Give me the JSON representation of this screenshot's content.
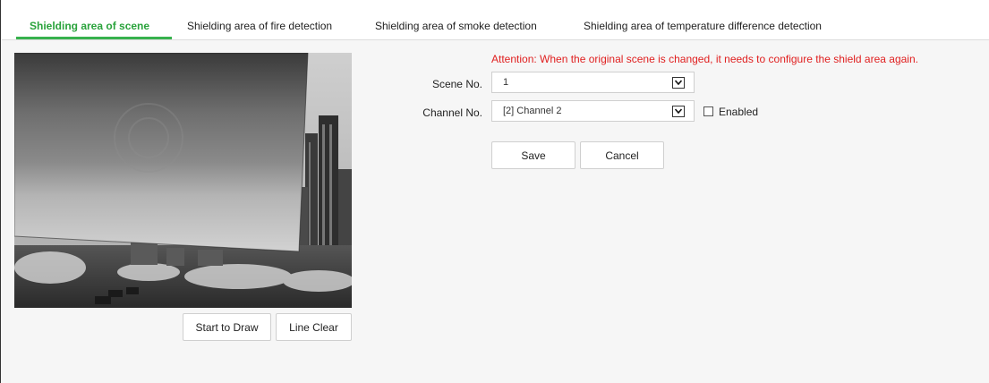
{
  "tabs": [
    {
      "label": "Shielding area of scene",
      "active": true
    },
    {
      "label": "Shielding area of fire detection",
      "active": false
    },
    {
      "label": "Shielding area of smoke detection",
      "active": false
    },
    {
      "label": "Shielding area of temperature difference detection",
      "active": false
    }
  ],
  "accent_color": "#37b24d",
  "attention_color": "#e02020",
  "video": {
    "buttons": {
      "start_draw": "Start to Draw",
      "line_clear": "Line Clear"
    }
  },
  "form": {
    "attention": "Attention: When the original scene is changed, it needs to configure the shield area again.",
    "scene_label": "Scene No.",
    "scene_value": "1",
    "channel_label": "Channel No.",
    "channel_value": "[2] Channel 2",
    "enabled_label": "Enabled",
    "enabled_checked": false,
    "save_label": "Save",
    "cancel_label": "Cancel"
  }
}
